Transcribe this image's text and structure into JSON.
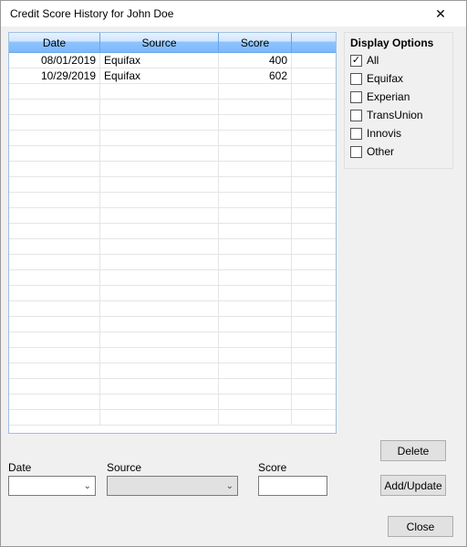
{
  "window": {
    "title": "Credit Score History for John Doe",
    "close_symbol": "✕"
  },
  "grid": {
    "columns": {
      "date": "Date",
      "source": "Source",
      "score": "Score"
    },
    "rows": [
      {
        "date": "08/01/2019",
        "source": "Equifax",
        "score": "400"
      },
      {
        "date": "10/29/2019",
        "source": "Equifax",
        "score": "602"
      }
    ],
    "blank_rows": 22
  },
  "display_options": {
    "title": "Display Options",
    "items": [
      {
        "label": "All",
        "checked": true
      },
      {
        "label": "Equifax",
        "checked": false
      },
      {
        "label": "Experian",
        "checked": false
      },
      {
        "label": "TransUnion",
        "checked": false
      },
      {
        "label": "Innovis",
        "checked": false
      },
      {
        "label": "Other",
        "checked": false
      }
    ]
  },
  "buttons": {
    "delete": "Delete",
    "add_update": "Add/Update",
    "close": "Close"
  },
  "fields": {
    "date": {
      "label": "Date",
      "value": ""
    },
    "source": {
      "label": "Source",
      "value": ""
    },
    "score": {
      "label": "Score",
      "value": ""
    }
  }
}
